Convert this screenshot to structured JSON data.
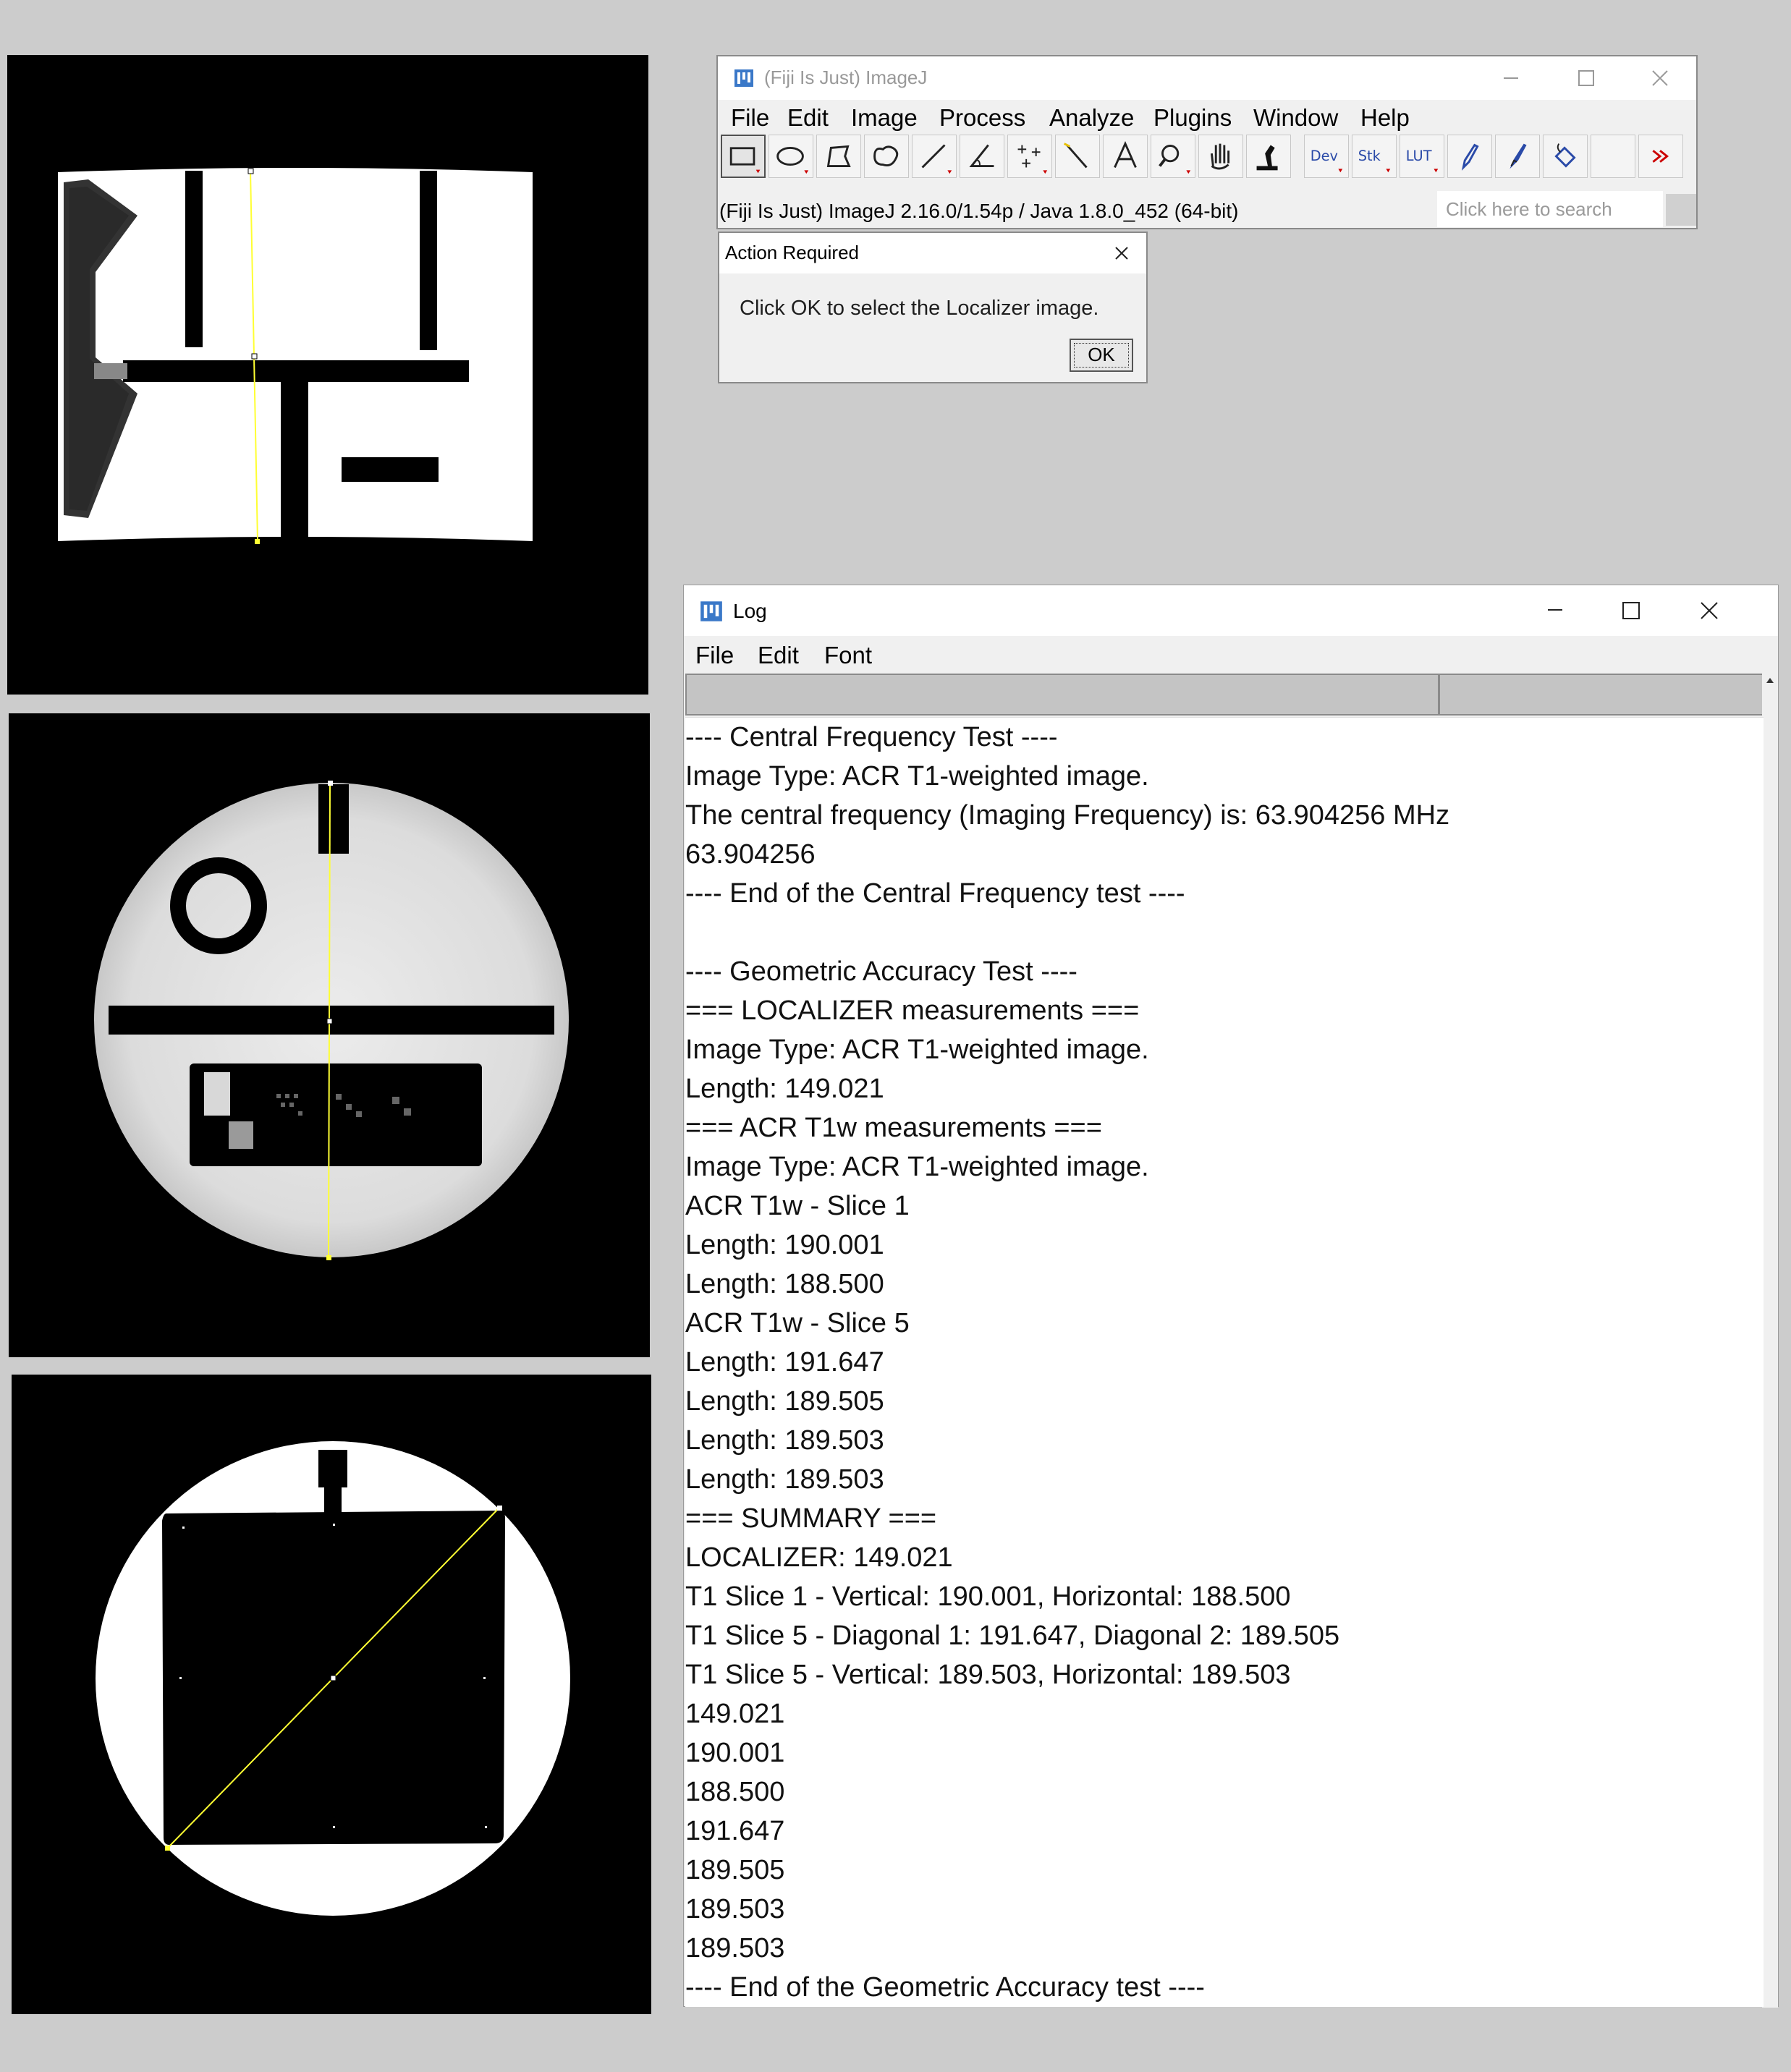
{
  "imagej_window": {
    "title": "(Fiji Is Just) ImageJ",
    "menu": [
      "File",
      "Edit",
      "Image",
      "Process",
      "Analyze",
      "Plugins",
      "Window",
      "Help"
    ],
    "tools": [
      "rectangle-tool-icon",
      "oval-tool-icon",
      "polygon-tool-icon",
      "freehand-tool-icon",
      "line-tool-icon",
      "angle-tool-icon",
      "multipoint-tool-icon",
      "wand-tool-icon",
      "text-tool-icon",
      "magnifier-tool-icon",
      "hand-tool-icon",
      "color-picker-tool-icon",
      "dev-menu",
      "stk-menu",
      "lut-menu",
      "pencil-tool-icon",
      "brush-tool-icon",
      "flood-fill-tool-icon",
      "blank-tool",
      "more-tools-icon"
    ],
    "tool_labels": {
      "dev": "Dev",
      "stk": "Stk",
      "lut": "LUT"
    },
    "status": "(Fiji Is Just) ImageJ 2.16.0/1.54p / Java 1.8.0_452 (64-bit)",
    "search_placeholder": "Click here to search"
  },
  "dialog": {
    "title": "Action Required",
    "message": "Click OK to select the Localizer image.",
    "ok_label": "OK"
  },
  "log_window": {
    "title": "Log",
    "menu": [
      "File",
      "Edit",
      "Font"
    ],
    "lines": [
      "---- Central Frequency Test ----",
      "Image Type: ACR T1-weighted image.",
      "The central frequency (Imaging Frequency) is: 63.904256 MHz",
      "63.904256",
      "---- End of the Central Frequency test ----",
      "",
      "---- Geometric Accuracy Test ----",
      "=== LOCALIZER measurements ===",
      "Image Type: ACR T1-weighted image.",
      "Length: 149.021",
      "=== ACR T1w measurements ===",
      "Image Type: ACR T1-weighted image.",
      "ACR T1w - Slice 1",
      "Length: 190.001",
      "Length: 188.500",
      "ACR T1w - Slice 5",
      "Length: 191.647",
      "Length: 189.505",
      "Length: 189.503",
      "Length: 189.503",
      "=== SUMMARY ===",
      "LOCALIZER: 149.021",
      "T1 Slice 1 - Vertical: 190.001, Horizontal: 188.500",
      "T1 Slice 5 - Diagonal 1: 191.647, Diagonal 2: 189.505",
      "T1 Slice 5 - Vertical: 189.503, Horizontal: 189.503",
      "149.021",
      "190.001",
      "188.500",
      "191.647",
      "189.505",
      "189.503",
      "189.503",
      "---- End of the Geometric Accuracy test ----"
    ]
  },
  "colors": {
    "desktop": "#cccccc",
    "measurement_line": "#ffff33",
    "icon_blue": "#3a78c8"
  }
}
